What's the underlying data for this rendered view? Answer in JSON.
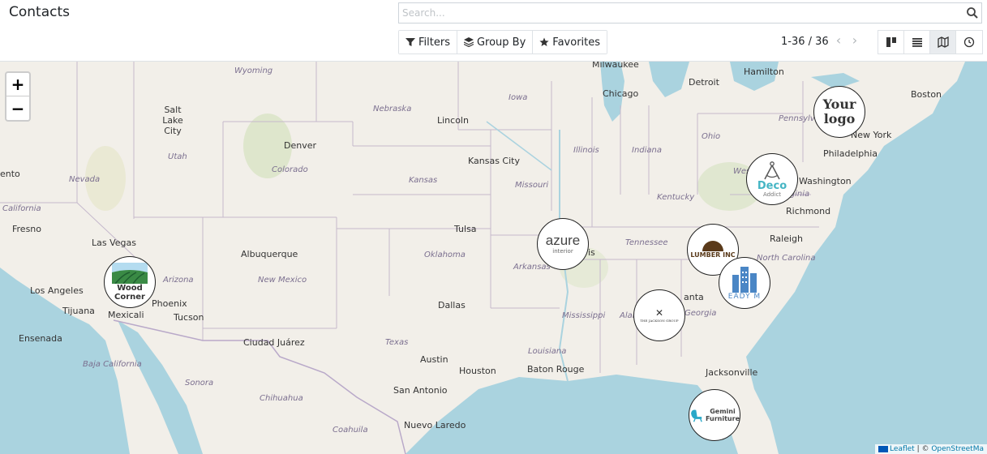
{
  "header": {
    "title": "Contacts",
    "search_placeholder": "Search...",
    "filters_label": "Filters",
    "groupby_label": "Group By",
    "favorites_label": "Favorites",
    "pager_text": "1-36 / 36"
  },
  "views": [
    "kanban",
    "list",
    "map",
    "activity"
  ],
  "active_view": "map",
  "map": {
    "zoom_in": "+",
    "zoom_out": "−",
    "attribution": {
      "leaflet": "Leaflet",
      "separator": " | © ",
      "osm": "OpenStreetMa"
    },
    "cities": [
      "Milwaukee",
      "Detroit",
      "Hamilton",
      "Chicago",
      "Boston",
      "New York",
      "Philadelphia",
      "Salt Lake City",
      "Lincoln",
      "Denver",
      "Kansas City",
      "Washington",
      "Richmond",
      "Raleigh",
      "Tulsa",
      "Fresno",
      "Las Vegas",
      "Albuquerque",
      "Los Angeles",
      "Phoenix",
      "Tijuana",
      "Mexicali",
      "Tucson",
      "Dallas",
      "Ensenada",
      "Ciudad Juárez",
      "Austin",
      "Houston",
      "Baton Rouge",
      "Jacksonville",
      "San Antonio",
      "Nuevo Laredo",
      "ento",
      "is",
      "anta"
    ],
    "states": [
      "Wyoming",
      "Nebraska",
      "Iowa",
      "Ohio",
      "Pennsylva",
      "Utah",
      "Colorado",
      "Nevada",
      "Kansas",
      "Missouri",
      "Illinois",
      "Indiana",
      "Kentucky",
      "West",
      "California",
      "Oklahoma",
      "Arkansas",
      "Tennessee",
      "North Carolina",
      "Arizona",
      "New Mexico",
      "Mississippi",
      "Alab",
      "Georgia",
      "Texas",
      "Louisiana",
      "Baja California",
      "Sonora",
      "Chihuahua",
      "Coahuila",
      "Virginia"
    ],
    "markers": [
      {
        "name": "Your logo",
        "text": "Your logo"
      },
      {
        "name": "Deco Addict",
        "text": "Deco",
        "sub": "Addict"
      },
      {
        "name": "Lumber Inc",
        "text": "LUMBER INC"
      },
      {
        "name": "Ready Mat",
        "text": "EADY M"
      },
      {
        "name": "Azure Interior",
        "text": "azure",
        "sub": "interior"
      },
      {
        "name": "The Jackson Group",
        "text": "THE JACKSON GROUP"
      },
      {
        "name": "Wood Corner",
        "text": "Wood",
        "sub": "Corner"
      },
      {
        "name": "Gemini Furniture",
        "text": "Gemini",
        "sub": "Furniture"
      }
    ]
  },
  "colors": {
    "water": "#aad3df",
    "land": "#f2efe9",
    "border": "#b9a9c9",
    "accent": "#714b67"
  }
}
